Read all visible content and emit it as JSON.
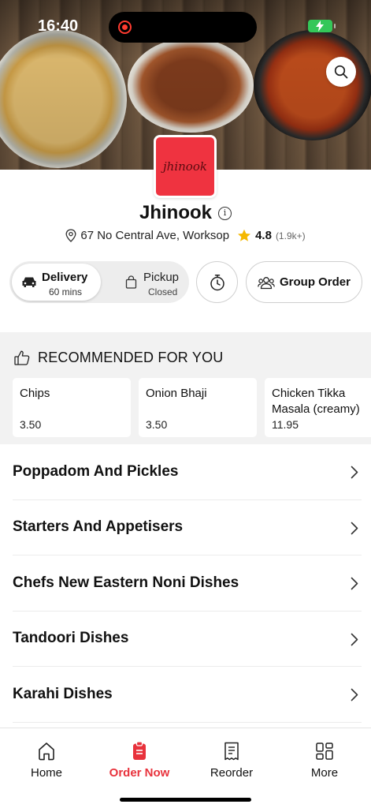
{
  "status_bar": {
    "time": "16:40"
  },
  "restaurant": {
    "logo_text": "jhinook",
    "name": "Jhinook",
    "address": "67 No Central Ave, Worksop",
    "rating": "4.8",
    "rating_count": "(1.9k+)"
  },
  "order_modes": {
    "delivery": {
      "label": "Delivery",
      "sub": "60 mins"
    },
    "pickup": {
      "label": "Pickup",
      "sub": "Closed"
    }
  },
  "group_order_label": "Group Order",
  "recommended": {
    "title": "RECOMMENDED FOR YOU",
    "items": [
      {
        "name": "Chips",
        "price": "3.50"
      },
      {
        "name": "Onion Bhaji",
        "price": "3.50"
      },
      {
        "name": "Chicken Tikka Masala (creamy)",
        "price": "11.95"
      }
    ]
  },
  "categories": [
    "Poppadom And Pickles",
    "Starters And Appetisers",
    "Chefs New Eastern Noni Dishes",
    "Tandoori Dishes",
    "Karahi Dishes"
  ],
  "bottom_nav": [
    {
      "label": "Home",
      "icon": "home-icon"
    },
    {
      "label": "Order Now",
      "icon": "order-icon",
      "active": true
    },
    {
      "label": "Reorder",
      "icon": "receipt-icon"
    },
    {
      "label": "More",
      "icon": "grid-icon"
    }
  ],
  "colors": {
    "accent": "#e8323c",
    "logo_bg": "#ef3340",
    "star": "#f5b800",
    "battery": "#34c759"
  }
}
